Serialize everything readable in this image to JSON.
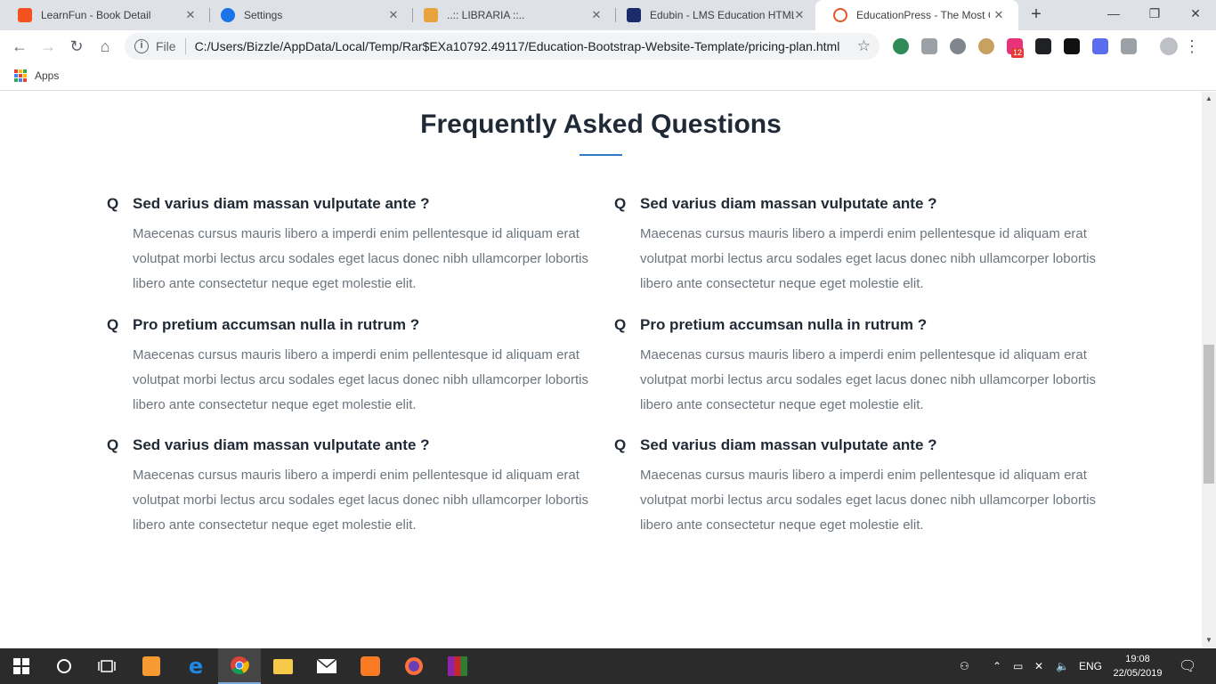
{
  "browser": {
    "tabs": [
      {
        "title": "LearnFun - Book Detail",
        "favicon_color": "#f4511e"
      },
      {
        "title": "Settings",
        "favicon_color": "#1a73e8"
      },
      {
        "title": "..:: LIBRARIA ::..",
        "favicon_color": "#e8a33d"
      },
      {
        "title": "Edubin - LMS Education HTML",
        "favicon_color": "#1b2a6b"
      },
      {
        "title": "EducationPress - The Most Co",
        "favicon_color": "#e8542b"
      }
    ],
    "active_tab": 4,
    "new_tab_label": "+",
    "address": {
      "scheme_label": "File",
      "url": "C:/Users/Bizzle/AppData/Local/Temp/Rar$EXa10792.49117/Education-Bootstrap-Website-Template/pricing-plan.html"
    },
    "bookmarks": {
      "apps_label": "Apps"
    },
    "extension_badge": "12"
  },
  "page": {
    "faq": {
      "title": "Frequently Asked Questions",
      "q_marker": "Q",
      "items": [
        {
          "question": "Sed varius diam massan vulputate ante ?",
          "answer": "Maecenas cursus mauris libero a imperdi enim pellentesque id aliquam erat volutpat morbi lectus arcu sodales eget lacus donec nibh ullamcorper lobortis libero ante consectetur neque eget molestie elit."
        },
        {
          "question": "Sed varius diam massan vulputate ante ?",
          "answer": "Maecenas cursus mauris libero a imperdi enim pellentesque id aliquam erat volutpat morbi lectus arcu sodales eget lacus donec nibh ullamcorper lobortis libero ante consectetur neque eget molestie elit."
        },
        {
          "question": "Pro pretium accumsan nulla in rutrum ?",
          "answer": "Maecenas cursus mauris libero a imperdi enim pellentesque id aliquam erat volutpat morbi lectus arcu sodales eget lacus donec nibh ullamcorper lobortis libero ante consectetur neque eget molestie elit."
        },
        {
          "question": "Pro pretium accumsan nulla in rutrum ?",
          "answer": "Maecenas cursus mauris libero a imperdi enim pellentesque id aliquam erat volutpat morbi lectus arcu sodales eget lacus donec nibh ullamcorper lobortis libero ante consectetur neque eget molestie elit."
        },
        {
          "question": "Sed varius diam massan vulputate ante ?",
          "answer": "Maecenas cursus mauris libero a imperdi enim pellentesque id aliquam erat volutpat morbi lectus arcu sodales eget lacus donec nibh ullamcorper lobortis libero ante consectetur neque eget molestie elit."
        },
        {
          "question": "Sed varius diam massan vulputate ante ?",
          "answer": "Maecenas cursus mauris libero a imperdi enim pellentesque id aliquam erat volutpat morbi lectus arcu sodales eget lacus donec nibh ullamcorper lobortis libero ante consectetur neque eget molestie elit."
        }
      ]
    }
  },
  "taskbar": {
    "language": "ENG",
    "time": "19:08",
    "date": "22/05/2019"
  },
  "colors": {
    "accent": "#2e7dc6",
    "heading": "#1f2a36",
    "body_text": "#6c757d"
  }
}
